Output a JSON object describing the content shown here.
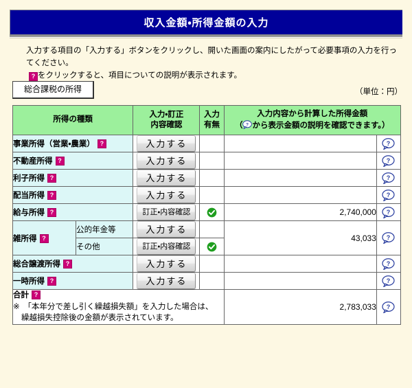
{
  "header": {
    "title": "収入金額・所得金額の入力"
  },
  "intro": {
    "line1": "入力する項目の「入力する」ボタンをクリックし、開いた画面の案内にしたがって必要事項の入力を行ってください。",
    "line2_after_icon": "をクリックすると、項目についての説明が表示されます。"
  },
  "tab": {
    "label": "総合課税の所得"
  },
  "unit_note": "（単位：円）",
  "table": {
    "columns": {
      "type": "所得の種類",
      "action_line1": "入力・訂正",
      "action_line2": "内容確認",
      "flag_line1": "入力",
      "flag_line2": "有無",
      "amount_line1": "入力内容から計算した所得金額",
      "amount_line2_before_icon": "（",
      "amount_line2_after_icon": "から表示金額の説明を確認できます。）",
      "help": ""
    },
    "rows": [
      {
        "label": "事業所得（営業・農業）",
        "button": "入力する",
        "button_kind": "input",
        "checked": false,
        "amount": ""
      },
      {
        "label": "不動産所得",
        "button": "入力する",
        "button_kind": "input",
        "checked": false,
        "amount": ""
      },
      {
        "label": "利子所得",
        "button": "入力する",
        "button_kind": "input",
        "checked": false,
        "amount": ""
      },
      {
        "label": "配当所得",
        "button": "入力する",
        "button_kind": "input",
        "checked": false,
        "amount": ""
      },
      {
        "label": "給与所得",
        "button": "訂正・内容確認",
        "button_kind": "verify",
        "checked": true,
        "amount": "2,740,000"
      }
    ],
    "misc_group": {
      "label": "雑所得",
      "amount": "43,033",
      "sub_rows": [
        {
          "label": "公的年金等",
          "button": "入力する",
          "button_kind": "input",
          "checked": false
        },
        {
          "label": "その他",
          "button": "訂正・内容確認",
          "button_kind": "verify",
          "checked": true
        }
      ]
    },
    "rows_after": [
      {
        "label": "総合譲渡所得",
        "button": "入力する",
        "button_kind": "input",
        "checked": false,
        "amount": ""
      },
      {
        "label": "一時所得",
        "button": "入力する",
        "button_kind": "input",
        "checked": false,
        "amount": ""
      }
    ],
    "total_row": {
      "title": "合計",
      "note_line1": "※　「本年分で差し引く繰越損失額」を入力した場合は、",
      "note_line2": "繰越損失控除後の金額が表示されています。",
      "amount": "2,783,033"
    }
  },
  "icons": {
    "question_glyph": "?",
    "bubble_glyph": "?",
    "check_glyph": "✓"
  },
  "colors": {
    "title_bar": "#000099",
    "table_header": "#9cf09c",
    "row_label": "#dcf7f7",
    "page_background": "#fdf8e3",
    "help_marker": "#cc0077",
    "check_green": "#1f9e1f",
    "bubble_blue": "#2b3fa0"
  }
}
